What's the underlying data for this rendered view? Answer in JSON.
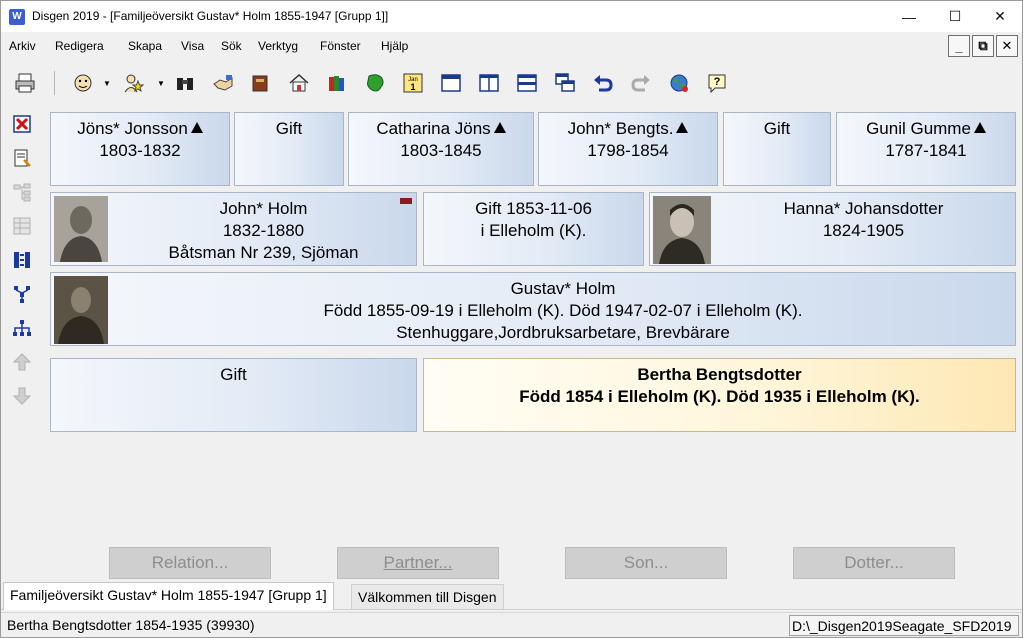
{
  "window": {
    "title": "Disgen 2019 - [Familjeöversikt Gustav* Holm 1855-1947 [Grupp 1]]",
    "app_icon_text": "W",
    "controls": [
      "—",
      "☐",
      "✕"
    ]
  },
  "menu": [
    "Arkiv",
    "Redigera",
    "Skapa",
    "Visa",
    "Sök",
    "Verktyg",
    "Fönster",
    "Hjälp"
  ],
  "mdi_controls": [
    "_",
    "⧉",
    "✕"
  ],
  "toolbar_icons": [
    "print-icon",
    "person-icon",
    "person-star-icon",
    "binoculars-icon",
    "handshake-icon",
    "book-icon",
    "home-icon",
    "books-icon",
    "map-icon",
    "calendar-icon",
    "window-icon",
    "split-vertical-icon",
    "split-horizontal-icon",
    "cascade-icon",
    "undo-icon",
    "redo-icon",
    "globe-icon",
    "help-icon"
  ],
  "calendar_icon_text": [
    "Jan",
    "1"
  ],
  "left_icons": [
    "delete-icon",
    "edit-document-icon",
    "tree-disabled-icon",
    "table-disabled-icon",
    "bars-icon",
    "descendant-tree-icon",
    "ancestor-tree-icon",
    "up-disabled-icon",
    "down-disabled-icon"
  ],
  "grandparents": [
    {
      "name": "Jöns* Jonsson",
      "years": "1803-1832",
      "has_arrow": true
    },
    {
      "name": "Gift",
      "years": "",
      "has_arrow": false
    },
    {
      "name": "Catharina Jöns",
      "years": "1803-1845",
      "has_arrow": true
    },
    {
      "name": "John* Bengts.",
      "years": "1798-1854",
      "has_arrow": true
    },
    {
      "name": "Gift",
      "years": "",
      "has_arrow": false
    },
    {
      "name": "Gunil Gumme",
      "years": "1787-1841",
      "has_arrow": true
    }
  ],
  "father": {
    "name": "John* Holm",
    "years": "1832-1880",
    "occupation": "Båtsman Nr 239, Sjöman"
  },
  "parents_marriage": {
    "line1": "Gift 1853-11-06",
    "line2": "i Elleholm (K)."
  },
  "mother": {
    "name": "Hanna* Johansdotter",
    "years": "1824-1905"
  },
  "main_person": {
    "name": "Gustav* Holm",
    "events": "Född 1855-09-19 i Elleholm (K). Död 1947-02-07 i Elleholm (K).",
    "occupation": "Stenhuggare,Jordbruksarbetare, Brevbärare"
  },
  "marriage": {
    "label": "Gift"
  },
  "spouse": {
    "name": "Bertha Bengtsdotter",
    "events": "Född 1854 i Elleholm (K). Död 1935 i Elleholm (K)."
  },
  "buttons": [
    {
      "label": "Relation...",
      "underline_char": ""
    },
    {
      "label": "Partner...",
      "underline_char": "P"
    },
    {
      "label": "Son...",
      "underline_char": "S"
    },
    {
      "label": "Dotter...",
      "underline_char": "D"
    }
  ],
  "tabs": [
    {
      "label": "Familjeöversikt Gustav* Holm 1855-1947 [Grupp 1]",
      "active": true
    },
    {
      "label": "Välkommen till Disgen",
      "active": false
    }
  ],
  "status": {
    "left": "Bertha Bengtsdotter 1854-1935 (39930)",
    "right": "D:\\_Disgen2019Seagate_SFD2019"
  },
  "colors": {
    "card_gradient_start": "#f4f7fb",
    "card_gradient_end": "#cad8ec",
    "selected_card_start": "#fffdf5",
    "selected_card_end": "#fde8b4",
    "badge": "#8b1a1a"
  }
}
